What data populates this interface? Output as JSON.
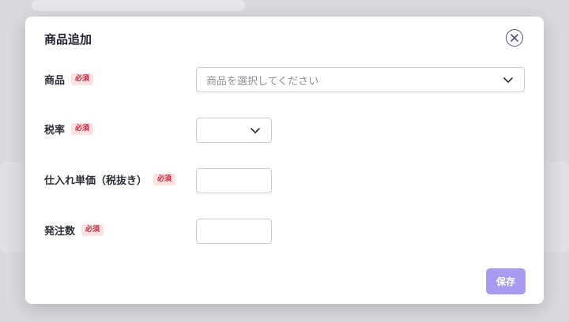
{
  "modal": {
    "title": "商品追加",
    "required_badge": "必須",
    "fields": {
      "product": {
        "label": "商品",
        "placeholder": "商品を選択してください"
      },
      "tax_rate": {
        "label": "税率",
        "value": ""
      },
      "purchase_price": {
        "label": "仕入れ単価（税抜き）",
        "value": ""
      },
      "order_quantity": {
        "label": "発注数",
        "value": ""
      }
    },
    "save_label": "保存"
  },
  "colors": {
    "primary_button": "#a79cf2",
    "required_badge_bg": "#fde2e4",
    "required_badge_text": "#c0273a"
  }
}
